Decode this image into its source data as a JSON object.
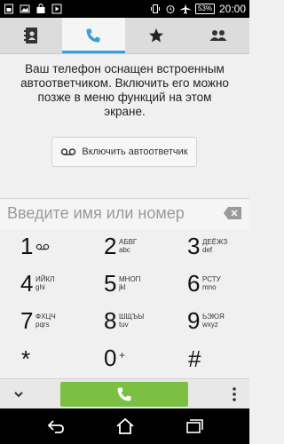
{
  "status_bar": {
    "time": "20:00",
    "battery": "53%",
    "left_icons": [
      "sim-card-icon",
      "image-icon",
      "shopping-bag-icon",
      "play-store-icon"
    ],
    "right_icons": [
      "vibrate-icon",
      "alarm-icon",
      "airplane-mode-icon",
      "battery-icon"
    ]
  },
  "tabs": [
    {
      "name": "tab-contacts",
      "icon": "contacts-icon",
      "active": false
    },
    {
      "name": "tab-phone",
      "icon": "phone-icon",
      "active": true
    },
    {
      "name": "tab-favorites",
      "icon": "star-icon",
      "active": false
    },
    {
      "name": "tab-groups",
      "icon": "groups-icon",
      "active": false
    }
  ],
  "voicemail_info": {
    "message": "Ваш телефон оснащен встроенным автоответчиком. Включить его можно позже в меню функций на этом экране.",
    "button_label": "Включить автоответчик"
  },
  "dialer": {
    "placeholder": "Введите имя или номер",
    "keys": [
      {
        "digit": "1",
        "letters": "",
        "letters2": ""
      },
      {
        "digit": "2",
        "letters": "АБВГ",
        "letters2": "abc"
      },
      {
        "digit": "3",
        "letters": "ДЕЁЖЗ",
        "letters2": "def"
      },
      {
        "digit": "4",
        "letters": "ИЙКЛ",
        "letters2": "ghi"
      },
      {
        "digit": "5",
        "letters": "МНОП",
        "letters2": "jkl"
      },
      {
        "digit": "6",
        "letters": "РСТУ",
        "letters2": "mno"
      },
      {
        "digit": "7",
        "letters": "ФХЦЧ",
        "letters2": "pqrs"
      },
      {
        "digit": "8",
        "letters": "ШЩЪЫ",
        "letters2": "tuv"
      },
      {
        "digit": "9",
        "letters": "ЬЭЮЯ",
        "letters2": "wxyz"
      },
      {
        "digit": "*",
        "letters": "",
        "letters2": ""
      },
      {
        "digit": "0",
        "letters": "+",
        "letters2": ""
      },
      {
        "digit": "#",
        "letters": "",
        "letters2": ""
      }
    ]
  },
  "colors": {
    "accent": "#3a9fd9",
    "call_button": "#7bc043"
  }
}
